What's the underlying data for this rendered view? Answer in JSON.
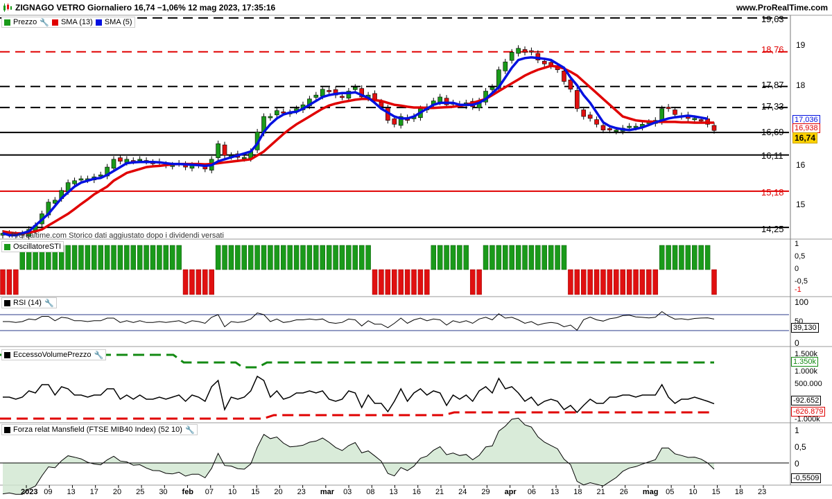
{
  "header": {
    "title": "ZIGNAGO VETRO Giornaliero 16,74 −1,06% 12 mag 2023, 17:35:16",
    "site": "www.ProRealTime.com"
  },
  "price_panel": {
    "legend": [
      "Prezzo",
      "SMA (13)",
      "SMA (5)"
    ],
    "levels": [
      {
        "label": "18,76",
        "value": 18.76,
        "color": "#e00000",
        "style": "dashed"
      },
      {
        "label": "17,87",
        "value": 17.87,
        "color": "#000000",
        "style": "dashed"
      },
      {
        "label": "17,33",
        "value": 17.33,
        "color": "#000000",
        "style": "dashed"
      },
      {
        "label": "16,69",
        "value": 16.69,
        "color": "#000000",
        "style": "solid"
      },
      {
        "label": "16,11",
        "value": 16.11,
        "color": "#000000",
        "style": "solid"
      },
      {
        "label": "15,18",
        "value": 15.18,
        "color": "#e00000",
        "style": "solid"
      },
      {
        "label": "14,25",
        "value": 14.25,
        "color": "#000000",
        "style": "solid"
      }
    ],
    "top_level": {
      "label": "19,63",
      "value": 19.63
    },
    "axis_ticks": [
      "19",
      "18",
      "17",
      "16",
      "15"
    ],
    "tags": {
      "sma5": "17,036",
      "sma13": "16,938",
      "price": "16,74"
    },
    "note": "Prorealtime.com Storico dati aggiustato dopo i dividendi versati"
  },
  "sti_panel": {
    "legend": "OscillatoreSTI",
    "ticks": [
      "1",
      "0,5",
      "0",
      "-0,5",
      "-1"
    ]
  },
  "rsi_panel": {
    "legend": "RSI (14)",
    "ticks": [
      "100",
      "50",
      "0"
    ],
    "value": "39,130"
  },
  "vol_panel": {
    "legend": "EccessoVolumePrezzo",
    "ticks": [
      "1.500k",
      "1.000k",
      "500.000"
    ],
    "upper": "1.350k",
    "value": "-92.652",
    "lower": "-626.879",
    "bottom": "-1.000k"
  },
  "mansfield_panel": {
    "legend": "Forza relat Mansfield (FTSE MIB40 Index) (52 10)",
    "ticks": [
      "1",
      "0,5",
      "0",
      "-0,5"
    ],
    "value": "-0,5509"
  },
  "x_axis": [
    "2023",
    "09",
    "13",
    "17",
    "20",
    "25",
    "30",
    "feb",
    "07",
    "10",
    "15",
    "20",
    "23",
    "mar",
    "03",
    "08",
    "13",
    "16",
    "21",
    "24",
    "29",
    "apr",
    "06",
    "13",
    "18",
    "21",
    "26",
    "mag",
    "05",
    "10",
    "15",
    "18",
    "23"
  ],
  "colors": {
    "up": "#1a9a1a",
    "down": "#e01010",
    "sma13": "#e00000",
    "sma5": "#0010e0",
    "vol_upper": "#138a13",
    "mans_fill_pos": "#cfe6cf",
    "mans_fill_neg": "#e6c6c6"
  },
  "chart_data": {
    "type": "candlestick",
    "y_range": [
      13.95,
      19.7
    ],
    "close": [
      14.1,
      14.1,
      14.05,
      14.05,
      14.2,
      14.3,
      14.6,
      14.9,
      14.95,
      15.2,
      15.4,
      15.45,
      15.5,
      15.5,
      15.55,
      15.6,
      15.8,
      16.0,
      15.95,
      16.0,
      15.95,
      16.0,
      15.95,
      15.9,
      15.9,
      15.85,
      15.85,
      15.9,
      15.8,
      15.85,
      15.85,
      15.75,
      16.0,
      16.4,
      16.1,
      16.1,
      16.05,
      16.05,
      16.2,
      16.7,
      17.1,
      17.1,
      17.25,
      17.2,
      17.2,
      17.3,
      17.4,
      17.55,
      17.65,
      17.8,
      17.75,
      17.65,
      17.6,
      17.75,
      17.85,
      17.6,
      17.65,
      17.5,
      17.35,
      17.0,
      16.9,
      17.1,
      17.0,
      17.1,
      17.3,
      17.35,
      17.5,
      17.6,
      17.4,
      17.45,
      17.4,
      17.45,
      17.35,
      17.5,
      17.75,
      17.85,
      18.3,
      18.5,
      18.75,
      18.85,
      18.75,
      18.75,
      18.55,
      18.45,
      18.4,
      18.3,
      18.0,
      17.8,
      17.3,
      17.1,
      17.05,
      16.9,
      16.75,
      16.75,
      16.75,
      16.8,
      16.85,
      16.85,
      16.9,
      16.95,
      17.0,
      17.3,
      17.3,
      17.15,
      17.1,
      17.05,
      17.05,
      17.0,
      16.9,
      16.74
    ],
    "sma13": [
      14.15,
      14.12,
      14.1,
      14.1,
      14.12,
      14.15,
      14.2,
      14.3,
      14.4,
      14.5,
      14.6,
      14.72,
      14.85,
      14.97,
      15.1,
      15.2,
      15.3,
      15.45,
      15.55,
      15.65,
      15.7,
      15.75,
      15.8,
      15.82,
      15.83,
      15.85,
      15.87,
      15.88,
      15.88,
      15.88,
      15.88,
      15.87,
      15.88,
      15.9,
      15.92,
      15.94,
      15.96,
      15.98,
      16.0,
      16.1,
      16.2,
      16.35,
      16.5,
      16.65,
      16.78,
      16.9,
      17.0,
      17.1,
      17.2,
      17.3,
      17.38,
      17.43,
      17.47,
      17.5,
      17.53,
      17.55,
      17.55,
      17.52,
      17.5,
      17.45,
      17.4,
      17.38,
      17.35,
      17.33,
      17.33,
      17.32,
      17.32,
      17.33,
      17.34,
      17.35,
      17.37,
      17.4,
      17.45,
      17.5,
      17.55,
      17.65,
      17.75,
      17.85,
      17.95,
      18.05,
      18.15,
      18.23,
      18.3,
      18.35,
      18.4,
      18.38,
      18.33,
      18.25,
      18.15,
      18.0,
      17.85,
      17.7,
      17.55,
      17.4,
      17.25,
      17.1,
      17.05,
      17.0,
      16.98,
      16.97,
      16.96,
      16.96,
      16.96,
      16.96,
      16.95,
      16.95,
      16.94,
      16.94,
      16.94,
      16.94
    ],
    "sma5": [
      14.1,
      14.05,
      14.05,
      14.1,
      14.15,
      14.3,
      14.45,
      14.6,
      14.8,
      15.0,
      15.15,
      15.3,
      15.4,
      15.45,
      15.5,
      15.52,
      15.6,
      15.7,
      15.8,
      15.9,
      15.92,
      15.93,
      15.93,
      15.93,
      15.92,
      15.9,
      15.88,
      15.88,
      15.87,
      15.86,
      15.85,
      15.83,
      15.85,
      15.95,
      16.0,
      16.05,
      16.1,
      16.15,
      16.2,
      16.4,
      16.7,
      16.9,
      17.05,
      17.15,
      17.2,
      17.22,
      17.3,
      17.4,
      17.5,
      17.6,
      17.65,
      17.68,
      17.7,
      17.7,
      17.72,
      17.65,
      17.58,
      17.45,
      17.3,
      17.2,
      17.1,
      17.05,
      17.05,
      17.1,
      17.2,
      17.3,
      17.4,
      17.45,
      17.45,
      17.45,
      17.4,
      17.4,
      17.4,
      17.45,
      17.55,
      17.7,
      17.85,
      18.1,
      18.35,
      18.55,
      18.6,
      18.62,
      18.6,
      18.58,
      18.55,
      18.45,
      18.35,
      18.1,
      17.9,
      17.65,
      17.45,
      17.2,
      16.95,
      16.85,
      16.8,
      16.77,
      16.75,
      16.78,
      16.82,
      16.88,
      16.95,
      17.0,
      17.05,
      17.08,
      17.1,
      17.12,
      17.1,
      17.07,
      17.04
    ]
  }
}
